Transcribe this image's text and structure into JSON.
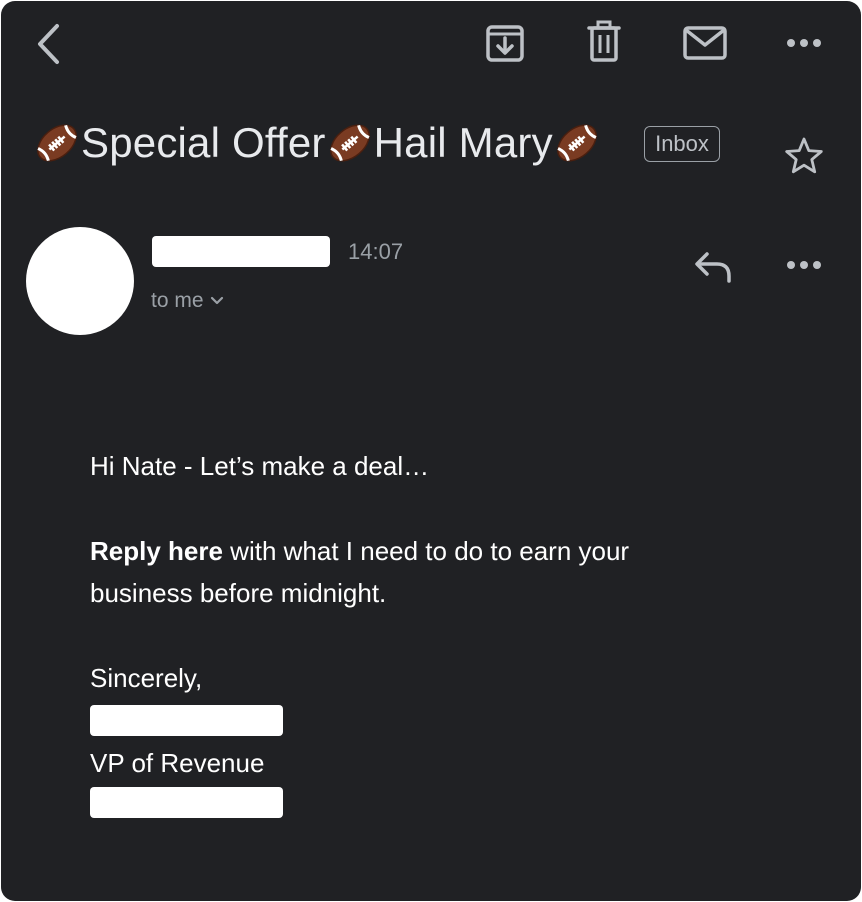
{
  "toolbar": {
    "back_icon": "chevron-left-icon",
    "archive_icon": "archive-icon",
    "delete_icon": "trash-icon",
    "mark_unread_icon": "mail-icon",
    "more_icon": "more-horizontal-icon"
  },
  "email": {
    "subject_part1": "Special Offer ",
    "subject_part2": "Hail Mary",
    "subject_emoji": "football",
    "label": "Inbox",
    "starred": false,
    "sender": {
      "name_redacted": true,
      "time": "14:07",
      "recipient": "to me"
    },
    "body": {
      "greeting": "Hi Nate - Let’s make a deal…",
      "cta_bold": "Reply here",
      "cta_rest_line1": " with what I need to do to earn your",
      "cta_rest_line2": "business before midnight.",
      "signoff": "Sincerely,",
      "title": "VP of Revenue"
    }
  },
  "colors": {
    "background": "#202124",
    "text": "#e8eaed",
    "muted": "#9aa0a6",
    "redaction": "#ffffff"
  }
}
